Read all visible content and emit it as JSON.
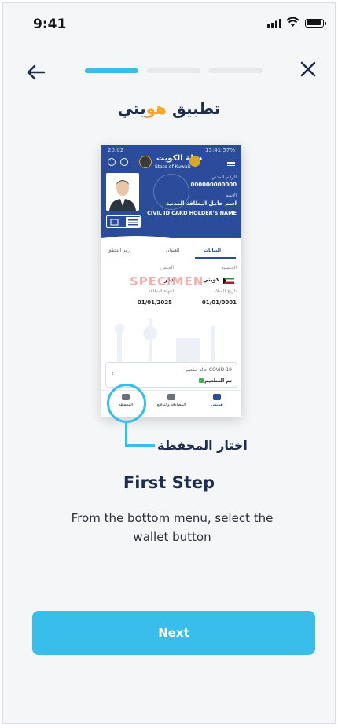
{
  "status_bar": {
    "time": "9:41"
  },
  "onboarding": {
    "brand_prefix": "تطبيق ",
    "brand_accent": "هو",
    "brand_suffix": "يتي",
    "callout": "اختار المحفظة",
    "step_title": "First Step",
    "step_description": "From the bottom menu, select the wallet button",
    "next_label": "Next",
    "progress": {
      "total": 3,
      "current": 1
    }
  },
  "phone_preview": {
    "status_time": "20:02",
    "status_right": "15:41 57%",
    "state_name": "State of Kuwait",
    "state_name_ar": "دولة الكويت",
    "civil_id_label": "الرقم المدني",
    "civil_id": "000000000000",
    "name_label": "الاسم",
    "name_ar": "اسم حامل البطاقة المدنية",
    "name_en": "CIVIL ID CARD HOLDER'S NAME",
    "tabs": [
      "البيانات",
      "العنوان",
      "رمز التحقق"
    ],
    "nationality_label": "الجنسية",
    "nationality_value": "كويتي",
    "sex_label": "الجنس",
    "sex_value": "ذكر",
    "birth_label": "تاريخ الميلاد",
    "birth_value": "01/01/0001",
    "expiry_label": "انتهاء البطاقة",
    "expiry_value": "01/01/2025",
    "specimen": "SPECIMEN",
    "covid_label": "حالة تطعيم COVID-19",
    "covid_status": "تم التطعيم",
    "nav": [
      "المحفظة",
      "المصادقة والتوقيع",
      "هويتي"
    ]
  },
  "colors": {
    "accent": "#39bdea",
    "navy": "#1e2c4e",
    "brand_orange": "#f6a623",
    "card_blue": "#2a4c9a"
  }
}
